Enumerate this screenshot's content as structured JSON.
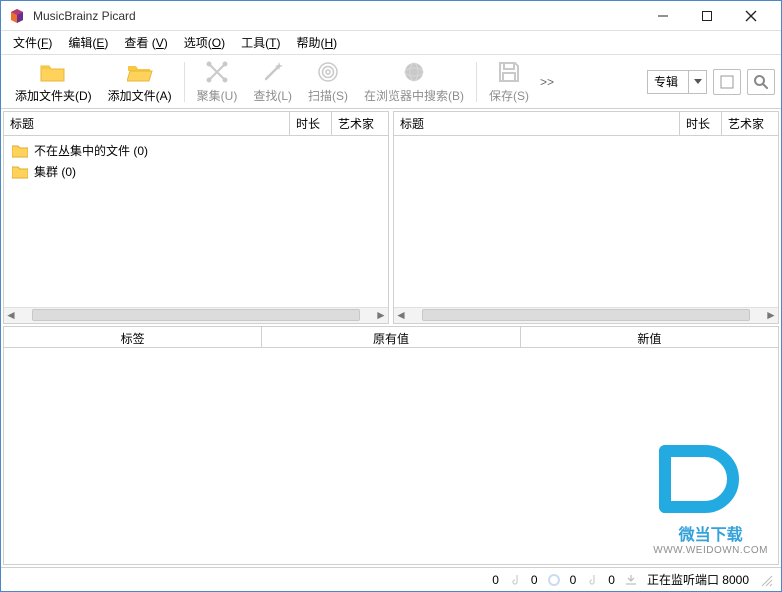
{
  "window": {
    "title": "MusicBrainz Picard"
  },
  "menu": {
    "file": {
      "label": "文件",
      "accel": "F"
    },
    "edit": {
      "label": "编辑",
      "accel": "E"
    },
    "view": {
      "label": "查看",
      "accel": "V"
    },
    "options": {
      "label": "选项",
      "accel": "O"
    },
    "tools": {
      "label": "工具",
      "accel": "T"
    },
    "help": {
      "label": "帮助",
      "accel": "H"
    }
  },
  "toolbar": {
    "add_folder": "添加文件夹(D)",
    "add_file": "添加文件(A)",
    "cluster": "聚集(U)",
    "lookup": "查找(L)",
    "scan": "扫描(S)",
    "browser": "在浏览器中搜索(B)",
    "save": "保存(S)",
    "more": ">>"
  },
  "search": {
    "combo_value": "专辑"
  },
  "columns": {
    "title": "标题",
    "duration": "时长",
    "artist": "艺术家"
  },
  "left_tree": {
    "item1": "不在丛集中的文件 (0)",
    "item2": "集群 (0)"
  },
  "tag_header": {
    "tag": "标签",
    "orig": "原有值",
    "new": "新值"
  },
  "status": {
    "c1": "0",
    "c2": "0",
    "c3": "0",
    "c4": "0",
    "listening": "正在监听端口 8000"
  },
  "watermark": {
    "name": "微当下载",
    "url": "WWW.WEIDOWN.COM"
  }
}
